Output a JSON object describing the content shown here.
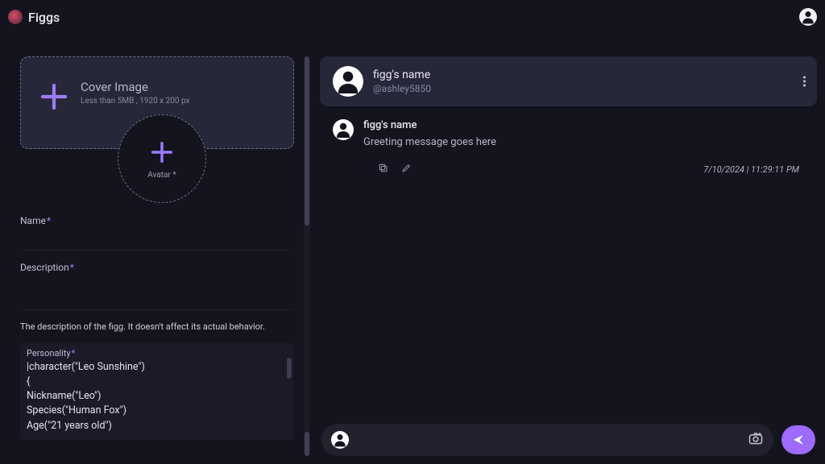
{
  "brand": {
    "name": "Figgs"
  },
  "left": {
    "cover": {
      "title": "Cover Image",
      "hint": "Less than 5MB , 1920 x 200 px"
    },
    "avatar_label": "Avatar *",
    "fields": {
      "name_label": "Name",
      "description_label": "Description",
      "helper": "The description of the figg. It doesn't affect its actual behavior.",
      "personality_label": "Personality",
      "personality_value": "|character(\"Leo Sunshine\")\n{\nNickname(\"Leo\")\nSpecies(\"Human Fox\")\nAge(\"21 years old\")"
    }
  },
  "chat": {
    "header": {
      "name": "figg's name",
      "handle": "@ashley5850"
    },
    "message": {
      "name": "figg's name",
      "text": "Greeting message goes here",
      "timestamp": "7/10/2024 | 11:29:11 PM"
    },
    "input_placeholder": ""
  }
}
